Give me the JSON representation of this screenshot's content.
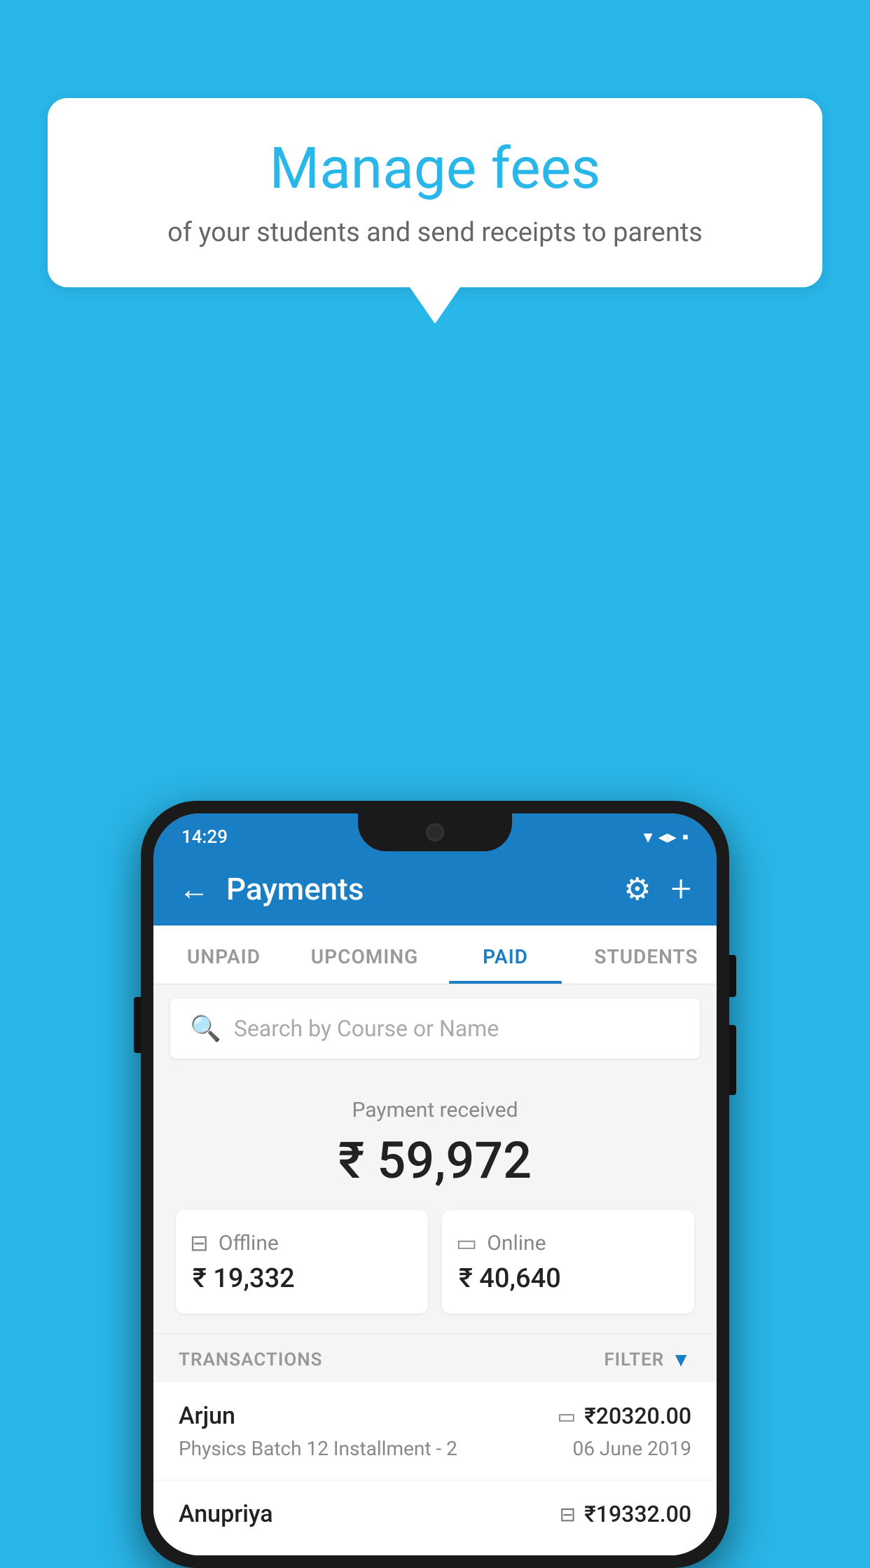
{
  "background_color": "#29b6e8",
  "speech_bubble": {
    "title": "Manage fees",
    "subtitle": "of your students and send receipts to parents"
  },
  "status_bar": {
    "time": "14:29",
    "wifi": "▼",
    "signal": "▲",
    "battery": "▪"
  },
  "header": {
    "title": "Payments",
    "back_label": "←",
    "settings_label": "⚙",
    "add_label": "+"
  },
  "tabs": [
    {
      "label": "UNPAID",
      "active": false
    },
    {
      "label": "UPCOMING",
      "active": false
    },
    {
      "label": "PAID",
      "active": true
    },
    {
      "label": "STUDENTS",
      "active": false
    }
  ],
  "search": {
    "placeholder": "Search by Course or Name"
  },
  "payment_summary": {
    "label": "Payment received",
    "amount": "₹ 59,972",
    "offline": {
      "label": "Offline",
      "amount": "₹ 19,332"
    },
    "online": {
      "label": "Online",
      "amount": "₹ 40,640"
    }
  },
  "transactions": {
    "header_label": "TRANSACTIONS",
    "filter_label": "FILTER",
    "items": [
      {
        "name": "Arjun",
        "course": "Physics Batch 12 Installment - 2",
        "amount": "₹20320.00",
        "date": "06 June 2019",
        "type": "online"
      },
      {
        "name": "Anupriya",
        "course": "",
        "amount": "₹19332.00",
        "date": "",
        "type": "offline"
      }
    ]
  }
}
